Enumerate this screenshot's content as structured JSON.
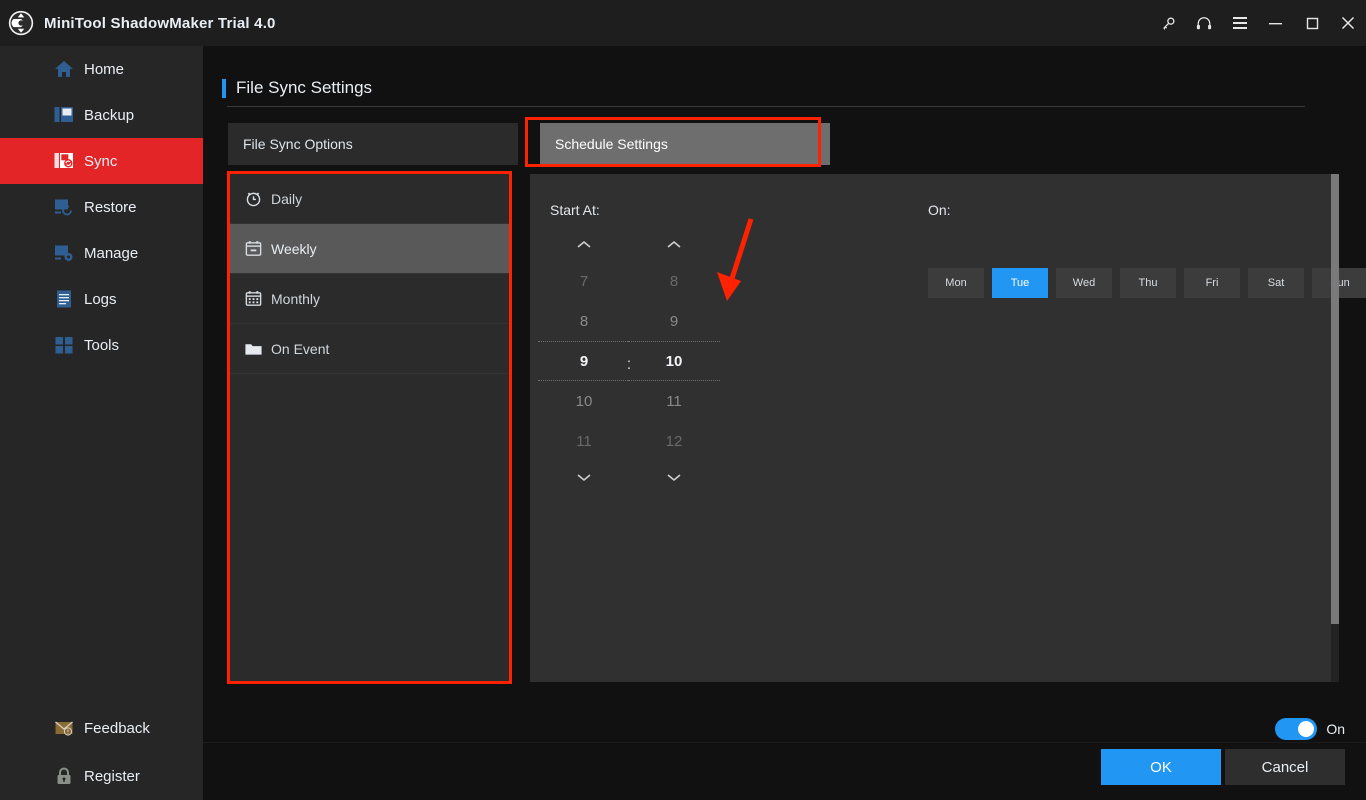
{
  "titlebar": {
    "app_title": "MiniTool ShadowMaker Trial 4.0",
    "logo_name": "minitool-logo",
    "buttons": [
      {
        "name": "key-icon",
        "label": "Key"
      },
      {
        "name": "headset-icon",
        "label": "Support"
      },
      {
        "name": "menu-icon",
        "label": "Menu"
      },
      {
        "name": "minimize-icon",
        "label": "Minimize"
      },
      {
        "name": "maximize-icon",
        "label": "Maximize"
      },
      {
        "name": "close-icon",
        "label": "Close"
      }
    ]
  },
  "sidebar": {
    "items": [
      {
        "label": "Home",
        "icon": "home-icon",
        "active": false
      },
      {
        "label": "Backup",
        "icon": "backup-icon",
        "active": false
      },
      {
        "label": "Sync",
        "icon": "sync-icon",
        "active": true
      },
      {
        "label": "Restore",
        "icon": "restore-icon",
        "active": false
      },
      {
        "label": "Manage",
        "icon": "manage-icon",
        "active": false
      },
      {
        "label": "Logs",
        "icon": "logs-icon",
        "active": false
      },
      {
        "label": "Tools",
        "icon": "tools-icon",
        "active": false
      }
    ],
    "bottom_items": [
      {
        "label": "Feedback",
        "icon": "feedback-icon"
      },
      {
        "label": "Register",
        "icon": "lock-icon"
      }
    ],
    "active_color": "#e32528"
  },
  "page": {
    "title": "File Sync Settings",
    "accent_color": "#2196f3"
  },
  "tabs": [
    {
      "label": "File Sync Options",
      "selected": false
    },
    {
      "label": "Schedule Settings",
      "selected": true
    }
  ],
  "schedule_options": [
    {
      "label": "Daily",
      "icon": "alarm-clock-icon",
      "selected": false
    },
    {
      "label": "Weekly",
      "icon": "calendar-week-icon",
      "selected": true
    },
    {
      "label": "Monthly",
      "icon": "calendar-month-icon",
      "selected": false
    },
    {
      "label": "On Event",
      "icon": "folder-icon",
      "selected": false
    }
  ],
  "schedule_panel": {
    "start_at_label": "Start At:",
    "on_label": "On:",
    "colon": ":",
    "hour": {
      "above2": "7",
      "above1": "8",
      "current": "9",
      "below1": "10",
      "below2": "11"
    },
    "minute": {
      "above2": "8",
      "above1": "9",
      "current": "10",
      "below1": "11",
      "below2": "12"
    },
    "days": [
      {
        "label": "Mon",
        "selected": false
      },
      {
        "label": "Tue",
        "selected": true
      },
      {
        "label": "Wed",
        "selected": false
      },
      {
        "label": "Thu",
        "selected": false
      },
      {
        "label": "Fri",
        "selected": false
      },
      {
        "label": "Sat",
        "selected": false
      },
      {
        "label": "Sun",
        "selected": false
      }
    ],
    "selected_day_color": "#2196f3"
  },
  "footer": {
    "toggle_label": "On",
    "toggle_on": true,
    "ok_label": "OK",
    "cancel_label": "Cancel"
  },
  "annotations": {
    "highlight_color": "#ff2200",
    "arrow_name": "red-arrow-pointing-to-weekly"
  }
}
